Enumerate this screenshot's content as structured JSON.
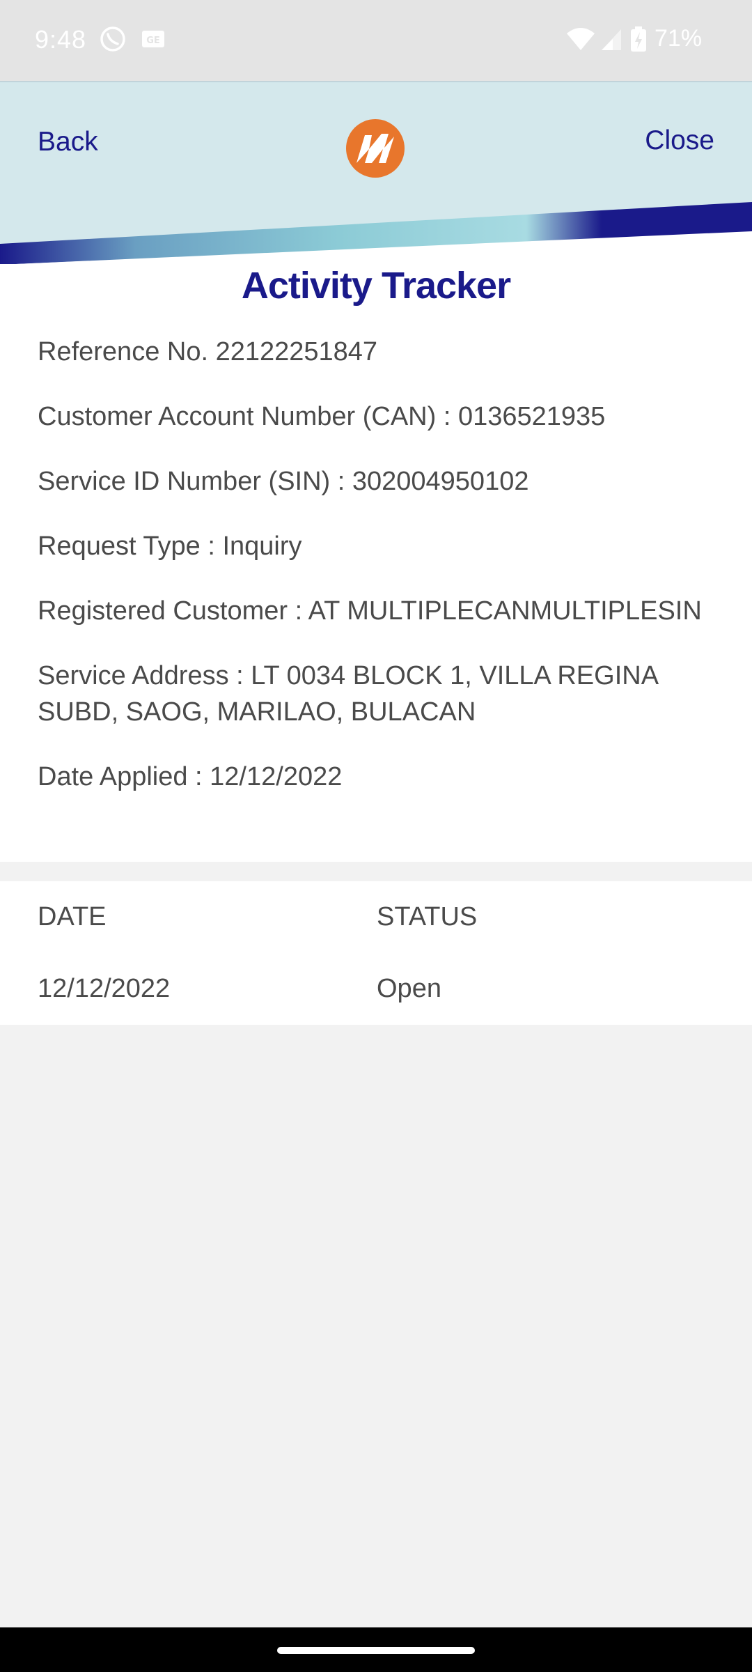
{
  "status_bar": {
    "time": "9:48",
    "battery": "71%",
    "icons": [
      "viber-icon",
      "sim-icon",
      "wifi-icon",
      "signal-icon",
      "battery-icon"
    ]
  },
  "header": {
    "back_label": "Back",
    "close_label": "Close",
    "logo_icon": "meralco-logo-icon",
    "colors": {
      "brand_blue": "#1a1a8a",
      "brand_orange": "#e8762c",
      "header_bg": "#d4e8ec"
    }
  },
  "main": {
    "title": "Activity Tracker",
    "details": [
      "Reference No. 22122251847",
      "Customer Account Number (CAN) : 0136521935",
      "Service ID Number (SIN) : 302004950102",
      "Request Type : Inquiry",
      "Registered Customer : AT MULTIPLECANMULTIPLESIN",
      "Service Address : LT 0034 BLOCK 1, VILLA REGINA SUBD, SAOG, MARILAO, BULACAN",
      "Date Applied : 12/12/2022"
    ]
  },
  "table": {
    "columns": [
      "DATE",
      "STATUS"
    ],
    "rows": [
      [
        "12/12/2022",
        "Open"
      ]
    ]
  }
}
